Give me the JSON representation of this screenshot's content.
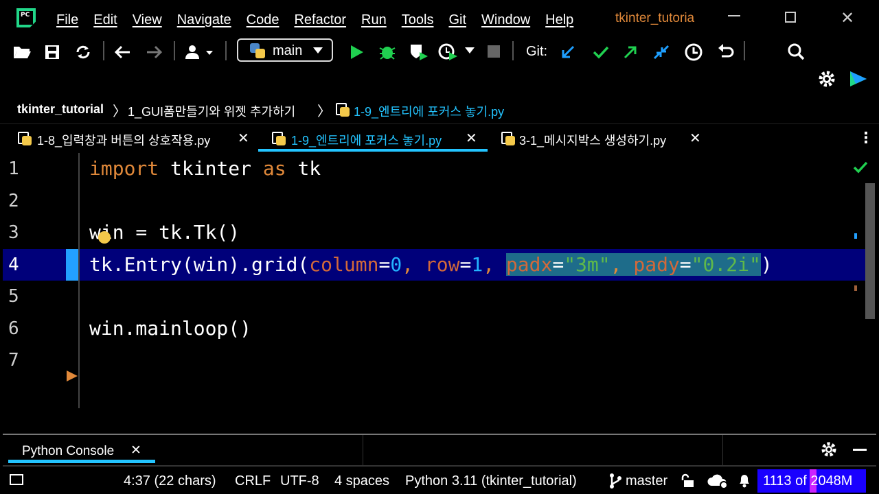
{
  "app": {
    "menu": [
      "File",
      "Edit",
      "View",
      "Navigate",
      "Code",
      "Refactor",
      "Run",
      "Tools",
      "Git",
      "Window",
      "Help"
    ],
    "project_title": "tkinter_tutoria"
  },
  "toolbar": {
    "branch": "main",
    "git_label": "Git:"
  },
  "breadcrumb": {
    "project": "tkinter_tutorial",
    "folder": "1_GUI폼만들기와 위젯 추가하기",
    "file": "1-9_엔트리에 포커스 놓기.py"
  },
  "tabs": [
    {
      "label": "1-8_입력창과 버튼의 상호작용.py",
      "active": false
    },
    {
      "label": "1-9_엔트리에 포커스 놓기.py",
      "active": true
    },
    {
      "label": "3-1_메시지박스 생성하기.py",
      "active": false
    }
  ],
  "editor": {
    "line_numbers": [
      "1",
      "2",
      "3",
      "4",
      "5",
      "6",
      "7"
    ],
    "line1": {
      "kw_import": "import",
      "mod": " tkinter ",
      "kw_as": "as",
      "alias": " tk"
    },
    "line3": "win = tk.Tk()",
    "line4": {
      "pre": "tk.Entry(win).grid(",
      "p1": "column",
      "eq1": "=",
      "v1": "0",
      "c1": ", ",
      "p2": "row",
      "eq2": "=",
      "v2": "1",
      "c2": ", ",
      "p3": "padx",
      "eq3": "=",
      "v3": "\"3m\"",
      "c3": ", ",
      "p4": "pady",
      "eq4": "=",
      "v4": "\"0.2i\"",
      "post": ")"
    },
    "line6": "win.mainloop()"
  },
  "bottom_panel": {
    "tab": "Python Console"
  },
  "status": {
    "position": "4:37 (22 chars)",
    "line_sep": "CRLF",
    "encoding": "UTF-8",
    "indent": "4 spaces",
    "interpreter": "Python 3.11 (tkinter_tutorial)",
    "vcs_branch": "master",
    "memory": "1113 of 2048M",
    "memory_fraction": 0.543
  },
  "colors": {
    "accent_orange": "#e1893a",
    "line_highlight": "#00007a",
    "selection": "#1e6c8a",
    "memory_bar": "#1a00ff"
  }
}
